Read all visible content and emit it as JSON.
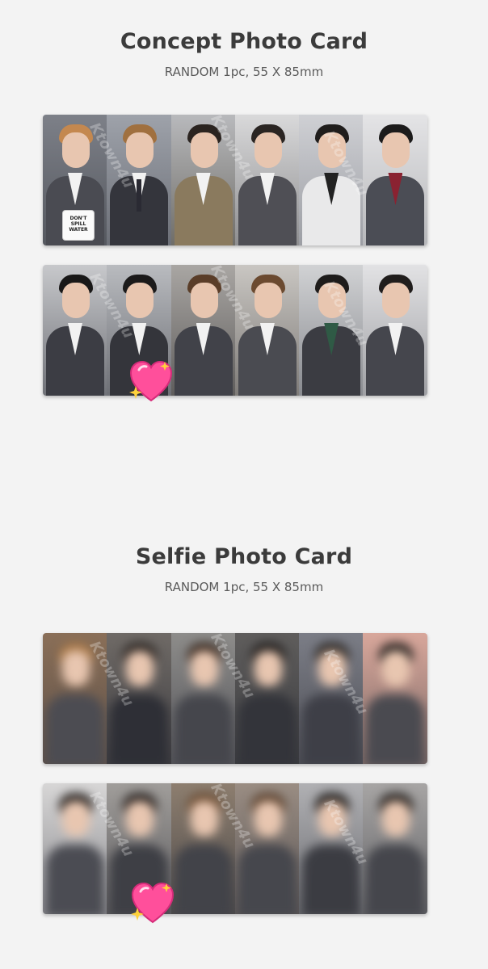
{
  "concept": {
    "title": "Concept Photo Card",
    "subtitle": "RANDOM 1pc, 55 X 85mm"
  },
  "selfie": {
    "title": "Selfie Photo Card",
    "subtitle": "RANDOM 1pc, 55 X 85mm"
  },
  "mug_text": "DON'T SPILL WATER",
  "watermark_text": "Ktown4u",
  "icons": {
    "heart": "sparkling-heart-icon"
  },
  "colors": {
    "background": "#f3f3f3",
    "heart": "#ff4f9b"
  }
}
